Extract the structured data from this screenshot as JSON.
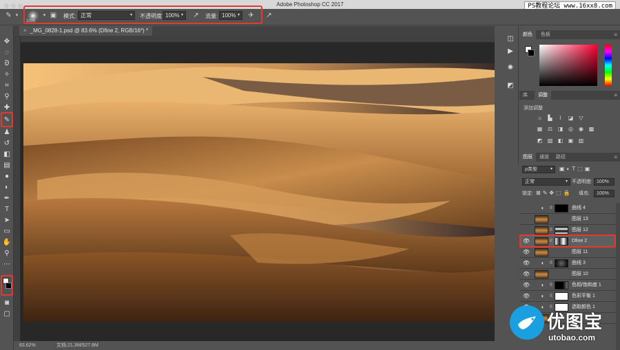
{
  "window": {
    "title": "Adobe Photoshop CC 2017",
    "watermark": "PS教程论坛 www.16xx8.com"
  },
  "options": {
    "brush_size": "1000",
    "mode_label": "模式:",
    "mode_value": "正常",
    "opacity_label": "不透明度:",
    "opacity_value": "100%",
    "flow_label": "流量:",
    "flow_value": "100%"
  },
  "document": {
    "tab_label": "_MG_0828-1.psd @ 83.6% (Dfine 2, RGB/16*) *",
    "zoom": "83.62%",
    "doc_info": "文档:21.3M/527.8M"
  },
  "panels": {
    "color_tab": "颜色",
    "swatches_tab": "色板",
    "library_tab": "库",
    "adjust_tab": "调整",
    "add_adjustment": "添加调整",
    "layers_tab": "图层",
    "channels_tab": "通道",
    "paths_tab": "路径",
    "filter_kind": "ρ类型",
    "blend_mode": "正常",
    "opacity_label": "不透明度:",
    "opacity_value": "100%",
    "lock_label": "锁定:",
    "fill_label": "填充:",
    "fill_value": "100%"
  },
  "layers": [
    {
      "name": "曲线 4",
      "type": "adjustment",
      "visible": false,
      "mask": "black"
    },
    {
      "name": "图层 13",
      "type": "pixel",
      "visible": false,
      "mask": "none"
    },
    {
      "name": "图层 12",
      "type": "pixel",
      "visible": false,
      "mask": "bw"
    },
    {
      "name": "Dfine 2",
      "type": "pixel",
      "visible": true,
      "mask": "bw",
      "selected": true
    },
    {
      "name": "图层 11",
      "type": "pixel",
      "visible": true,
      "mask": "none"
    },
    {
      "name": "曲线 3",
      "type": "adjustment",
      "visible": true,
      "mask": "dark"
    },
    {
      "name": "图层 10",
      "type": "pixel",
      "visible": true,
      "mask": "none"
    },
    {
      "name": "色相/饱和度 1",
      "type": "adjustment",
      "visible": true,
      "mask": "black"
    },
    {
      "name": "色彩平衡 1",
      "type": "adjustment",
      "visible": true,
      "mask": "white"
    },
    {
      "name": "选取颜色 1",
      "type": "adjustment",
      "visible": true,
      "mask": "white"
    },
    {
      "name": "",
      "type": "pixel",
      "visible": true,
      "mask": "none"
    }
  ],
  "logo": {
    "cn": "优图宝",
    "en": "utobao.com"
  }
}
